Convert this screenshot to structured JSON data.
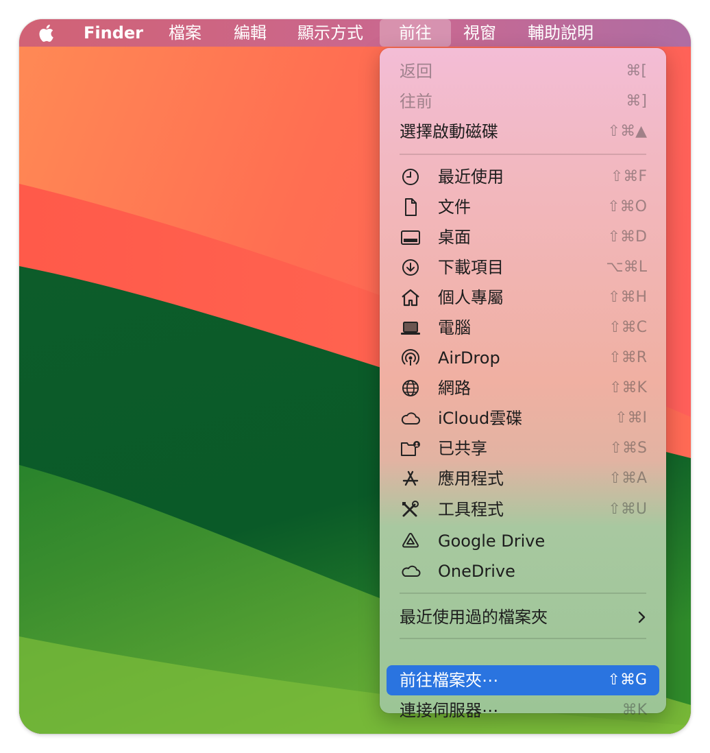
{
  "menubar": {
    "app_name": "Finder",
    "items": [
      "檔案",
      "編輯",
      "顯示方式",
      "前往",
      "視窗",
      "輔助說明"
    ]
  },
  "go_menu": {
    "nav": [
      {
        "label": "返回",
        "shortcut": "⌘[",
        "enabled": false
      },
      {
        "label": "往前",
        "shortcut": "⌘]",
        "enabled": false
      },
      {
        "label": "選擇啟動磁碟",
        "shortcut": "⇧⌘▲",
        "enabled": true
      }
    ],
    "places": [
      {
        "label": "最近使用",
        "shortcut": "⇧⌘F",
        "icon": "clock-icon"
      },
      {
        "label": "文件",
        "shortcut": "⇧⌘O",
        "icon": "document-icon"
      },
      {
        "label": "桌面",
        "shortcut": "⇧⌘D",
        "icon": "desktop-icon"
      },
      {
        "label": "下載項目",
        "shortcut": "⌥⌘L",
        "icon": "download-icon"
      },
      {
        "label": "個人專屬",
        "shortcut": "⇧⌘H",
        "icon": "home-icon"
      },
      {
        "label": "電腦",
        "shortcut": "⇧⌘C",
        "icon": "laptop-icon"
      },
      {
        "label": "AirDrop",
        "shortcut": "⇧⌘R",
        "icon": "airdrop-icon"
      },
      {
        "label": "網路",
        "shortcut": "⇧⌘K",
        "icon": "globe-icon"
      },
      {
        "label": "iCloud雲碟",
        "shortcut": "⇧⌘I",
        "icon": "cloud-icon"
      },
      {
        "label": "已共享",
        "shortcut": "⇧⌘S",
        "icon": "shared-folder-icon"
      },
      {
        "label": "應用程式",
        "shortcut": "⇧⌘A",
        "icon": "apps-icon"
      },
      {
        "label": "工具程式",
        "shortcut": "⇧⌘U",
        "icon": "tools-icon"
      },
      {
        "label": "Google Drive",
        "shortcut": "",
        "icon": "google-drive-icon"
      },
      {
        "label": "OneDrive",
        "shortcut": "",
        "icon": "cloud-icon"
      }
    ],
    "recent_folders": {
      "label": "最近使用過的檔案夾"
    },
    "go_to_folder": {
      "label": "前往檔案夾⋯",
      "shortcut": "⇧⌘G"
    },
    "connect_server": {
      "label": "連接伺服器⋯",
      "shortcut": "⌘K"
    }
  },
  "colors": {
    "highlight": "#2a74e0",
    "menubar": "#c95f7c",
    "wallpaper_orange": "#ff7a4e",
    "wallpaper_green": "#0b5a2a"
  }
}
